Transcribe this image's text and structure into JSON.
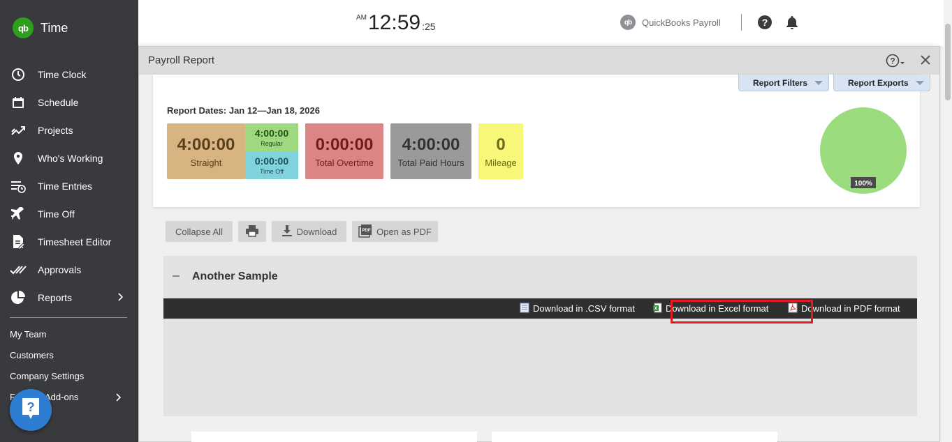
{
  "app": {
    "logo_text": "qb",
    "name": "Time"
  },
  "sidebar": {
    "items": [
      {
        "label": "Time Clock",
        "icon": "clock-icon"
      },
      {
        "label": "Schedule",
        "icon": "calendar-icon"
      },
      {
        "label": "Projects",
        "icon": "trend-icon"
      },
      {
        "label": "Who's Working",
        "icon": "location-pin-icon"
      },
      {
        "label": "Time Entries",
        "icon": "time-entries-icon"
      },
      {
        "label": "Time Off",
        "icon": "airplane-icon"
      },
      {
        "label": "Timesheet Editor",
        "icon": "edit-document-icon"
      },
      {
        "label": "Approvals",
        "icon": "double-check-icon"
      },
      {
        "label": "Reports",
        "icon": "pie-chart-icon"
      }
    ],
    "sub_items": [
      "My Team",
      "Customers",
      "Company Settings",
      "Feature Add-ons"
    ],
    "sub_items_visible": [
      "My Team",
      "Customers",
      "Company Settings",
      "F",
      "Add-ons"
    ]
  },
  "topbar": {
    "ampm": "AM",
    "time": "12:59",
    "seconds": ":25",
    "product": "QuickBooks Payroll",
    "product_logo": "qb"
  },
  "modal": {
    "title": "Payroll Report",
    "report_filters": "Report Filters",
    "report_exports": "Report Exports",
    "report_dates": "Report Dates: Jan 12—Jan 18, 2026",
    "stats": {
      "straight_value": "4:00:00",
      "straight_label": "Straight",
      "regular_value": "4:00:00",
      "regular_label": "Regular",
      "timeoff_value": "0:00:00",
      "timeoff_label": "Time Off",
      "overtime_value": "0:00:00",
      "overtime_label": "Total Overtime",
      "paid_value": "4:00:00",
      "paid_label": "Total Paid Hours",
      "mileage_value": "0",
      "mileage_label": "Mileage"
    },
    "pie_label": "100%",
    "actions": {
      "collapse_all": "Collapse All",
      "download": "Download",
      "open_pdf": "Open as PDF"
    },
    "section": {
      "title": "Another Sample",
      "csv": "Download in .CSV format",
      "excel": "Download in Excel format",
      "pdf": "Download in PDF format"
    }
  },
  "colors": {
    "sidebar_bg": "#393a3d",
    "qb_green": "#2ca01c",
    "straight": "#d9b483",
    "regular": "#9ed97f",
    "timeoff": "#7fd3dc",
    "overtime": "#dc8585",
    "paid": "#9a9a9a",
    "mileage": "#f7f77a",
    "pie": "#9bdc7f",
    "highlight": "#e01b24"
  }
}
